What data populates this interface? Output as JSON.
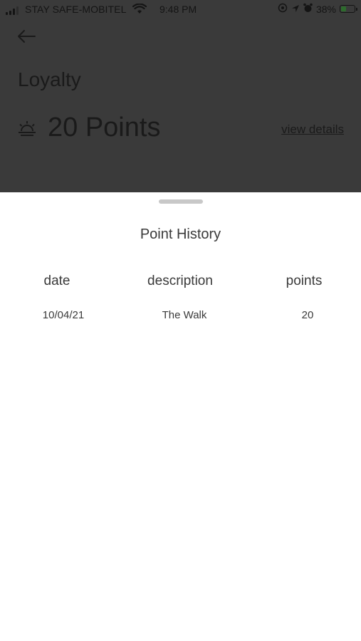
{
  "status_bar": {
    "carrier": "STAY SAFE-MOBITEL",
    "time": "9:48 PM",
    "battery": "38%"
  },
  "header": {
    "title": "Loyalty",
    "points": "20 Points",
    "view_details": "view details",
    "points_icon": "sunrise-icon"
  },
  "sheet": {
    "title": "Point History",
    "columns": [
      "date",
      "description",
      "points"
    ],
    "rows": [
      {
        "date": "10/04/21",
        "description": "The Walk",
        "points": "20"
      }
    ]
  },
  "colors": {
    "backdrop": "#3a3a3a",
    "sheet": "#ffffff",
    "text": "#3a3a3a"
  }
}
